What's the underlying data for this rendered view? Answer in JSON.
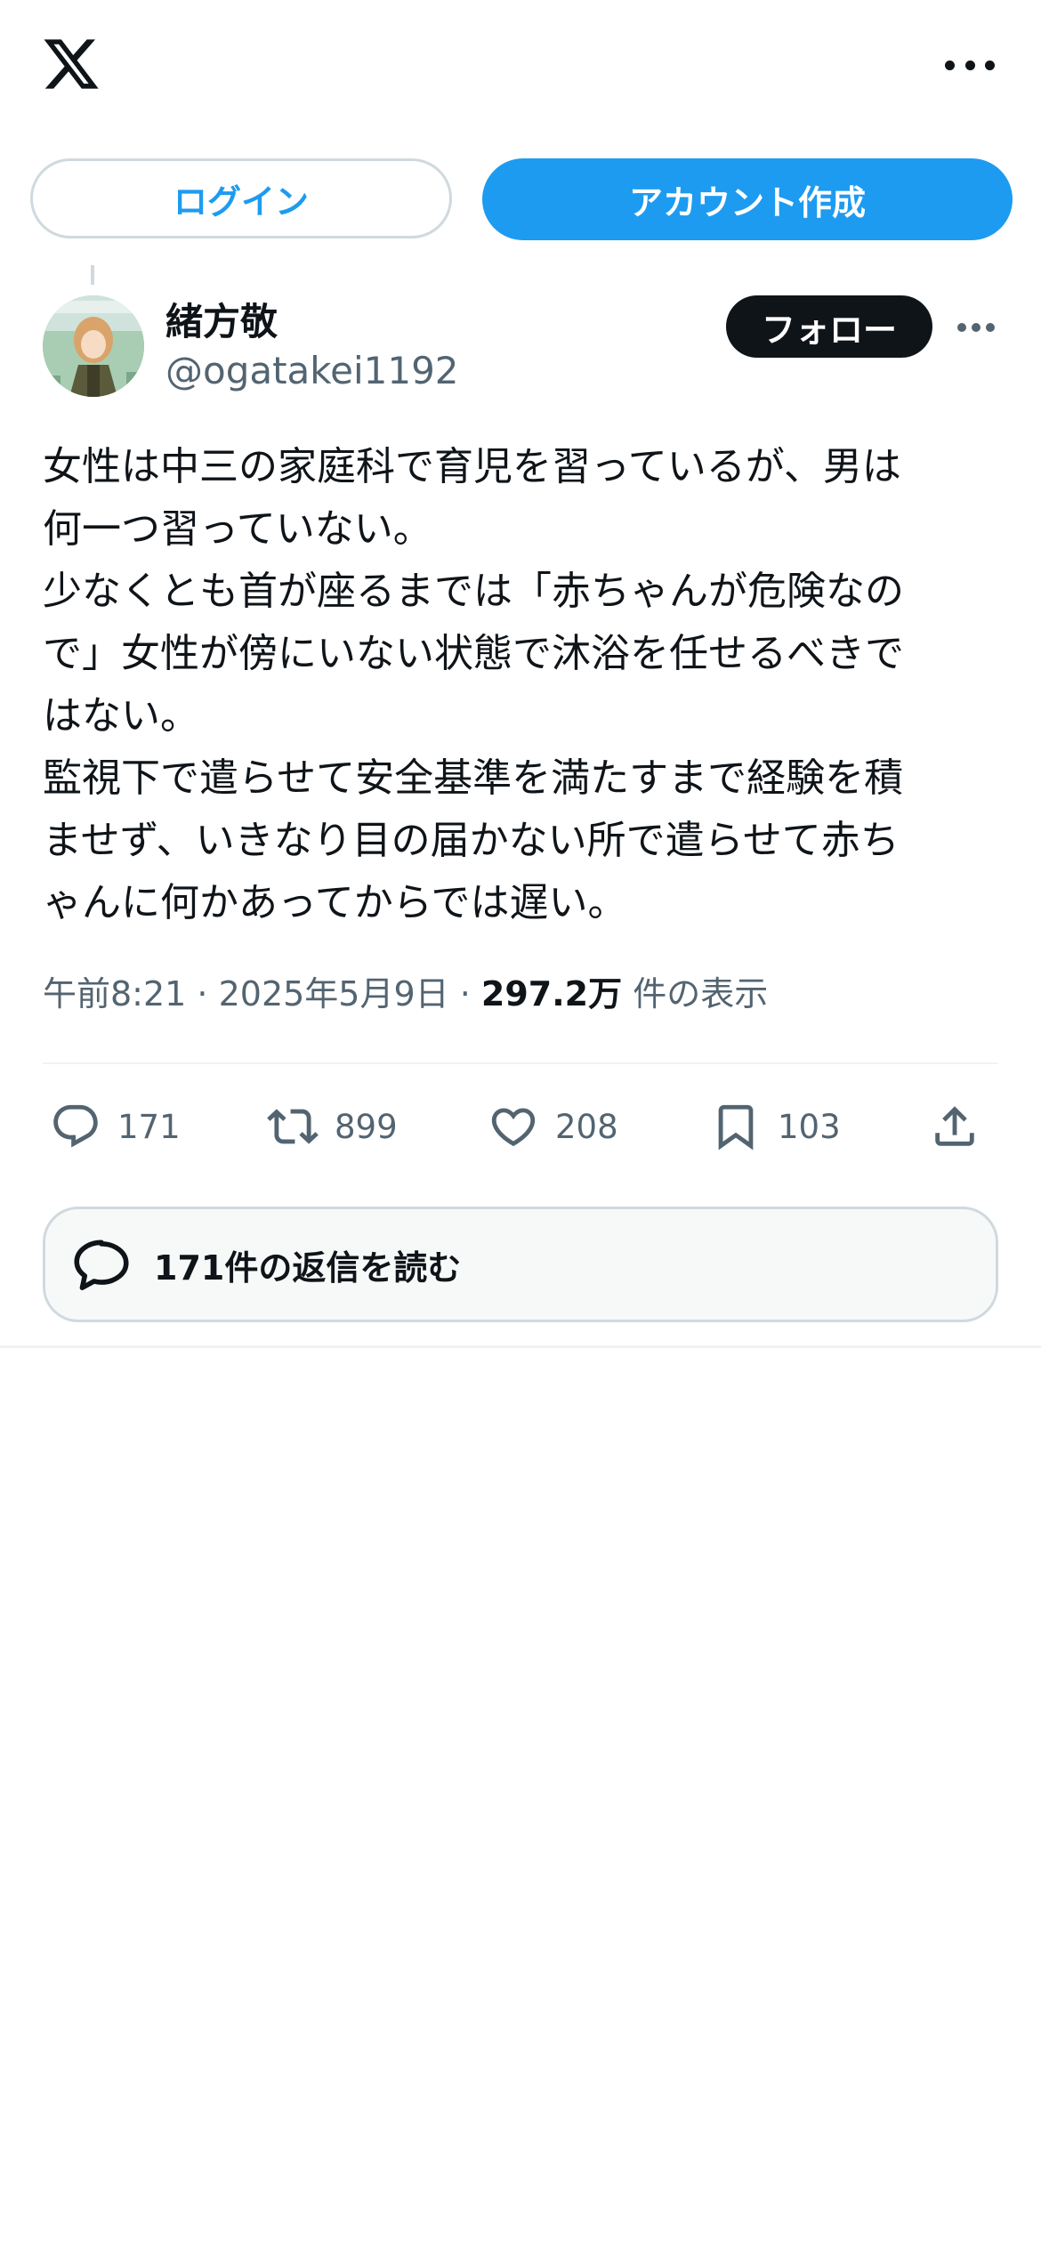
{
  "header": {
    "logo_icon": "x-logo-icon",
    "more_icon": "more-icon"
  },
  "auth": {
    "login_label": "ログイン",
    "signup_label": "アカウント作成"
  },
  "tweet": {
    "display_name": "緒方敬",
    "handle": "@ogatakei1192",
    "follow_label": "フォロー",
    "text": "女性は中三の家庭科で育児を習っているが、男は\n何一つ習っていない。\n少なくとも首が座るまでは「赤ちゃんが危険なの\nで」女性が傍にいない状態で沐浴を任せるべきで\nはない。\n監視下で遣らせて安全基準を満たすまで経験を積\nませず、いきなり目の届かない所で遣らせて赤ち\nゃんに何かあってからでは遅い。",
    "time": "午前8:21",
    "sep1": " · ",
    "date": "2025年5月9日",
    "sep2": " · ",
    "views": "297.2万",
    "views_label": " 件の表示"
  },
  "actions": {
    "reply_count": "171",
    "retweet_count": "899",
    "like_count": "208",
    "bookmark_count": "103"
  },
  "replies_button": {
    "label": "171件の返信を読む"
  },
  "colors": {
    "accent": "#1d9bf0",
    "text": "#0f1419",
    "muted": "#536471",
    "border": "#cfd9de"
  }
}
